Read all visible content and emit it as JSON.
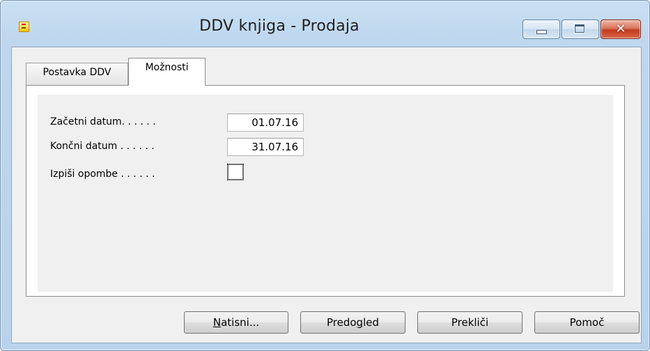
{
  "window": {
    "title": "DDV knjiga - Prodaja",
    "close_symbol": "✕"
  },
  "tabs": [
    {
      "label": "Postavka DDV",
      "active": false
    },
    {
      "label": "Možnosti",
      "active": true
    }
  ],
  "form": {
    "start_date": {
      "label": "Začetni datum. . . . . .",
      "value": "01.07.16"
    },
    "end_date": {
      "label": "Končni datum . . . . . .",
      "value": "31.07.16"
    },
    "print_notes": {
      "label": "Izpiši opombe . . . . . .",
      "checked": false
    }
  },
  "buttons": {
    "print": {
      "prefix": "",
      "mnemonic": "N",
      "suffix": "atisni..."
    },
    "preview": {
      "prefix": "Predo",
      "mnemonic": "g",
      "suffix": "led"
    },
    "cancel": {
      "label": "Prekliči"
    },
    "help": {
      "label": "Pomoč"
    }
  },
  "colors": {
    "frame": "#b9d3ec",
    "client": "#f0f0f0",
    "close_button": "#c3391d"
  },
  "icons": {
    "app": "form-icon",
    "minimize": "minimize-icon",
    "maximize": "maximize-icon",
    "close": "close-icon",
    "checkbox": "checkbox-icon"
  }
}
